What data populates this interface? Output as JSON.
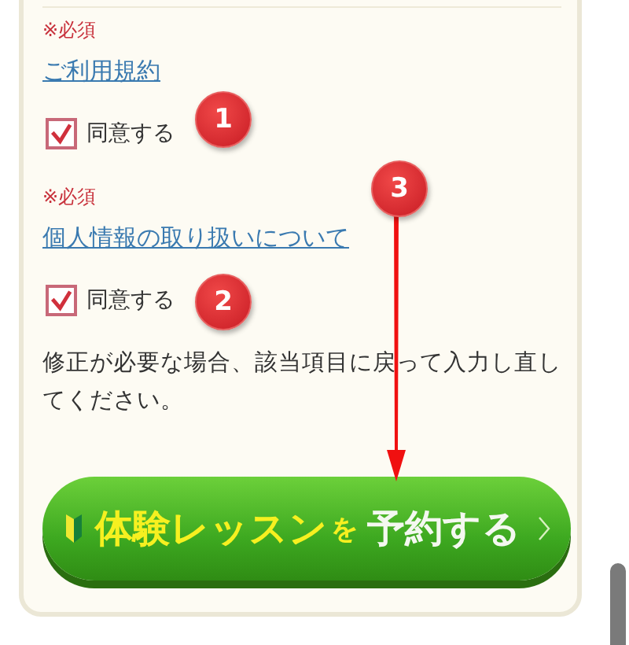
{
  "agreements": [
    {
      "required": "※必須",
      "link": "ご利用規約",
      "checkbox": {
        "label": "同意する",
        "checked": true
      }
    },
    {
      "required": "※必須",
      "link": "個人情報の取り扱いについて",
      "checkbox": {
        "label": "同意する",
        "checked": true
      }
    }
  ],
  "note": "修正が必要な場合、該当項目に戻って入力し直してください。",
  "submit_button": {
    "parts": [
      {
        "text": "体験レッスン",
        "kind": "highlight"
      },
      {
        "text": "を",
        "kind": "particle"
      },
      {
        "text": "予約する",
        "kind": "plain"
      }
    ]
  },
  "annotations": [
    {
      "label": "1"
    },
    {
      "label": "2"
    },
    {
      "label": "3"
    }
  ]
}
